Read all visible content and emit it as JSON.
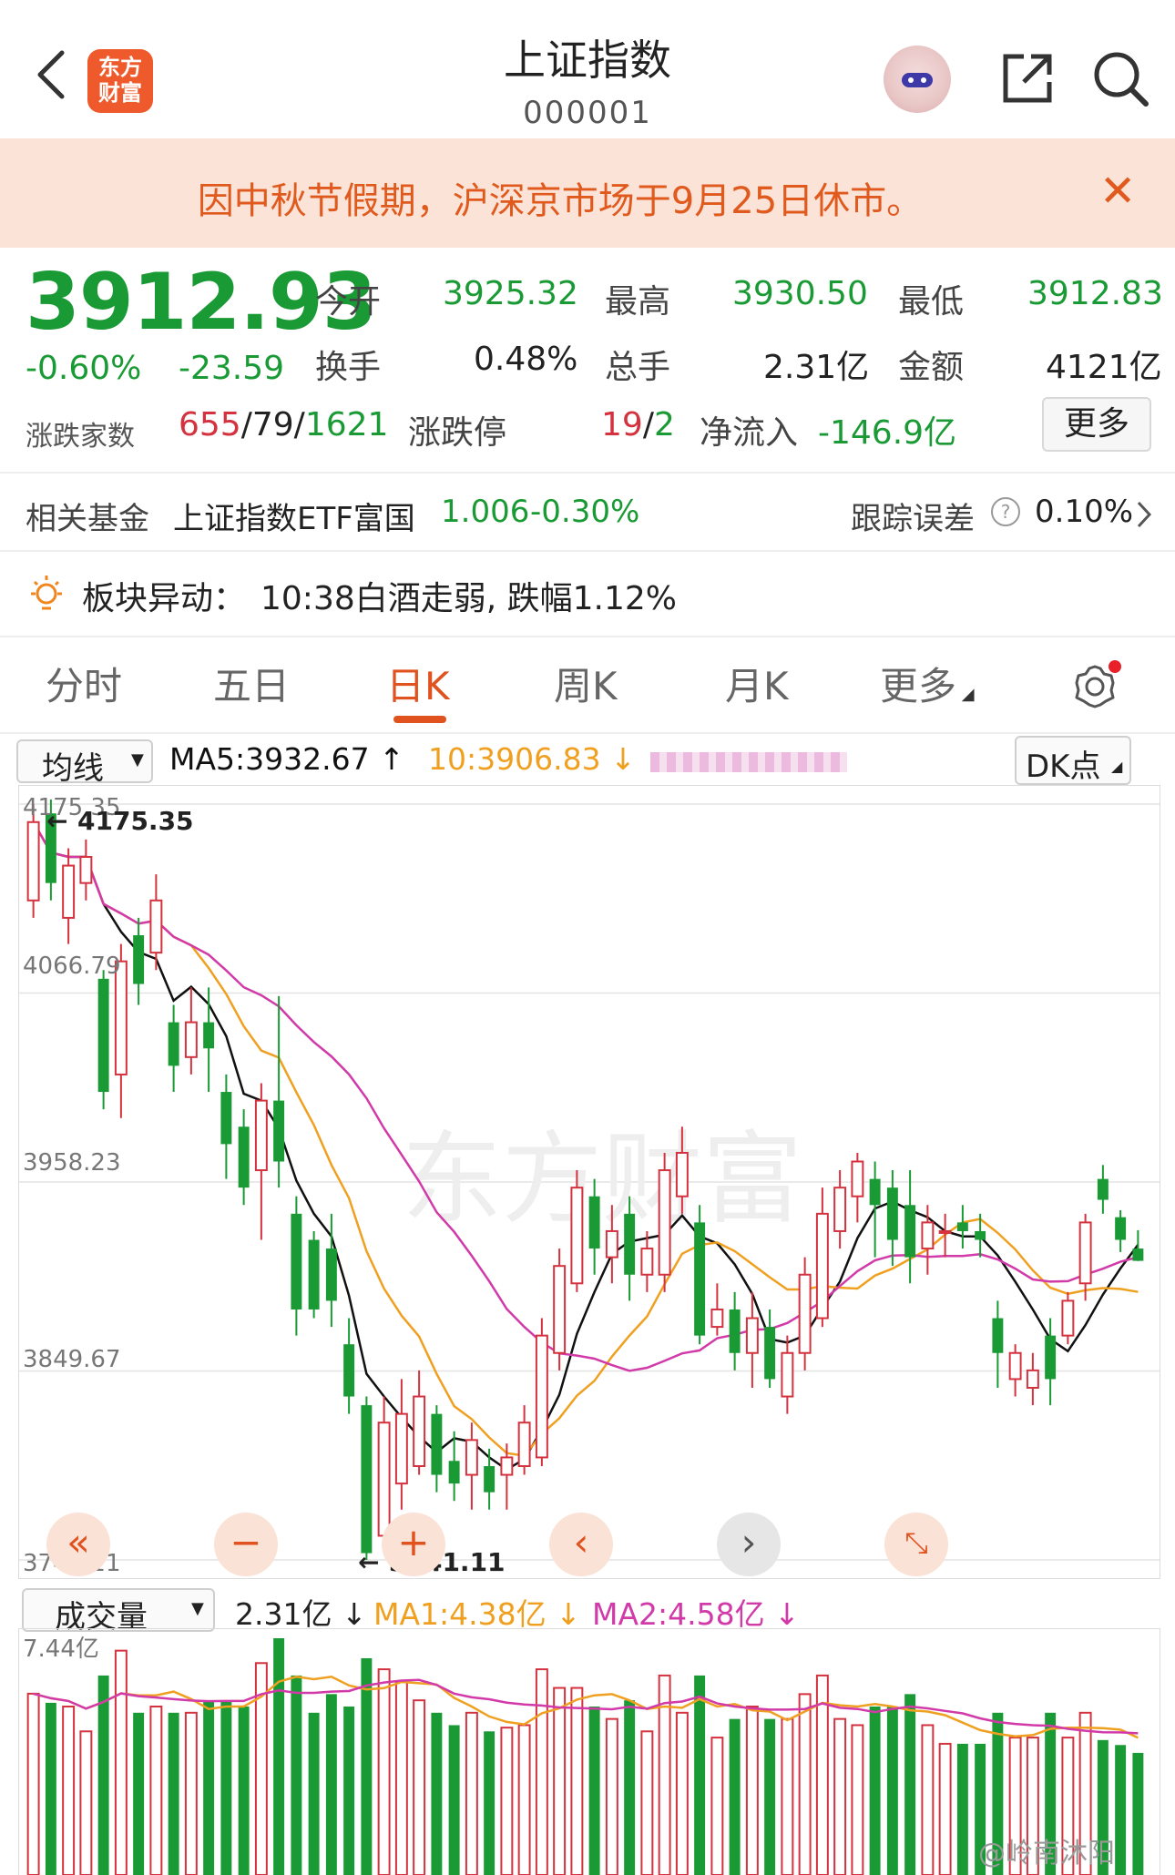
{
  "header": {
    "title": "上证指数",
    "code": "000001",
    "logo_text_line1": "东方",
    "logo_text_line2": "财富"
  },
  "notice": {
    "text": "因中秋节假期，沪深京市场于9月25日休市。"
  },
  "quote": {
    "price": "3912.93",
    "change_pct": "-0.60%",
    "change": "-23.59",
    "open_label": "今开",
    "open": "3925.32",
    "high_label": "最高",
    "high": "3930.50",
    "low_label": "最低",
    "low": "3912.83",
    "turnover_label": "换手",
    "turnover": "0.48%",
    "volume_label": "总手",
    "volume": "2.31亿",
    "amount_label": "金额",
    "amount": "4121亿",
    "breadth_label": "涨跌家数",
    "breadth_up": "655",
    "breadth_flat": "79",
    "breadth_down": "1621",
    "limit_label": "涨跌停",
    "limit_up": "19",
    "limit_down": "2",
    "inflow_label": "净流入",
    "inflow": "-146.9亿",
    "more_label": "更多"
  },
  "fund": {
    "label": "相关基金",
    "name": "上证指数ETF富国",
    "value": "1.006",
    "pct": "-0.30%",
    "track_label": "跟踪误差",
    "track_value": "0.10%"
  },
  "alert": {
    "label": "板块异动：",
    "text": "10:38白酒走弱, 跌幅1.12%"
  },
  "tabs": [
    {
      "label": "分时"
    },
    {
      "label": "五日"
    },
    {
      "label": "日K"
    },
    {
      "label": "周K"
    },
    {
      "label": "月K"
    },
    {
      "label": "更多"
    }
  ],
  "ma_bar": {
    "selector": "均线",
    "ma5": "MA5:3932.67",
    "ma10": "10:3906.83",
    "dk": "DK点"
  },
  "chart_axis": {
    "y1": "4175.35",
    "y2": "4066.79",
    "y3": "3958.23",
    "y4": "3849.67",
    "y5": "3741.11",
    "max_mark": "4175.35",
    "min_mark": "3741.11",
    "watermark": "东方财富"
  },
  "vol_bar": {
    "selector": "成交量",
    "vol": "2.31亿",
    "ma1": "MA1:4.38亿",
    "ma2": "MA2:4.58亿",
    "top": "7.44亿"
  },
  "footer": {
    "weibo": "@岭南沐阳"
  },
  "colors": {
    "up": "#d4323f",
    "down": "#1a9a34",
    "accent": "#e0521e",
    "ma5": "#111111",
    "ma10": "#f0a020",
    "ma20": "#d13aa8"
  },
  "chart_data": {
    "type": "candlestick",
    "ylim": [
      3741.11,
      4175.35
    ],
    "candles": [
      {
        "o": 4120,
        "c": 4165,
        "h": 4175.35,
        "l": 4110
      },
      {
        "o": 4170,
        "c": 4130,
        "h": 4178,
        "l": 4120
      },
      {
        "o": 4110,
        "c": 4140,
        "h": 4150,
        "l": 4095
      },
      {
        "o": 4130,
        "c": 4145,
        "h": 4155,
        "l": 4120
      },
      {
        "o": 4075,
        "c": 4010,
        "h": 4080,
        "l": 4000
      },
      {
        "o": 4020,
        "c": 4085,
        "h": 4095,
        "l": 3995
      },
      {
        "o": 4100,
        "c": 4072,
        "h": 4110,
        "l": 4060
      },
      {
        "o": 4090,
        "c": 4120,
        "h": 4135,
        "l": 4080
      },
      {
        "o": 4050,
        "c": 4025,
        "h": 4060,
        "l": 4010
      },
      {
        "o": 4030,
        "c": 4050,
        "h": 4070,
        "l": 4020
      },
      {
        "o": 4050,
        "c": 4035,
        "h": 4070,
        "l": 4010
      },
      {
        "o": 4010,
        "c": 3980,
        "h": 4020,
        "l": 3960
      },
      {
        "o": 3990,
        "c": 3955,
        "h": 4000,
        "l": 3945
      },
      {
        "o": 3965,
        "c": 4005,
        "h": 4015,
        "l": 3925
      },
      {
        "o": 4005,
        "c": 3970,
        "h": 4065,
        "l": 3955
      },
      {
        "o": 3940,
        "c": 3885,
        "h": 3950,
        "l": 3870
      },
      {
        "o": 3925,
        "c": 3885,
        "h": 3930,
        "l": 3880
      },
      {
        "o": 3920,
        "c": 3890,
        "h": 3940,
        "l": 3875
      },
      {
        "o": 3865,
        "c": 3835,
        "h": 3880,
        "l": 3825
      },
      {
        "o": 3830,
        "c": 3745,
        "h": 3835,
        "l": 3741.11
      },
      {
        "o": 3755,
        "c": 3820,
        "h": 3835,
        "l": 3750
      },
      {
        "o": 3785,
        "c": 3825,
        "h": 3845,
        "l": 3770
      },
      {
        "o": 3795,
        "c": 3835,
        "h": 3850,
        "l": 3790
      },
      {
        "o": 3825,
        "c": 3790,
        "h": 3830,
        "l": 3780
      },
      {
        "o": 3798,
        "c": 3785,
        "h": 3815,
        "l": 3775
      },
      {
        "o": 3790,
        "c": 3810,
        "h": 3820,
        "l": 3770
      },
      {
        "o": 3795,
        "c": 3780,
        "h": 3805,
        "l": 3770
      },
      {
        "o": 3790,
        "c": 3800,
        "h": 3808,
        "l": 3770
      },
      {
        "o": 3795,
        "c": 3820,
        "h": 3830,
        "l": 3790
      },
      {
        "o": 3800,
        "c": 3870,
        "h": 3880,
        "l": 3795
      },
      {
        "o": 3860,
        "c": 3910,
        "h": 3920,
        "l": 3850
      },
      {
        "o": 3900,
        "c": 3955,
        "h": 3965,
        "l": 3895
      },
      {
        "o": 3950,
        "c": 3920,
        "h": 3960,
        "l": 3905
      },
      {
        "o": 3915,
        "c": 3930,
        "h": 3945,
        "l": 3900
      },
      {
        "o": 3940,
        "c": 3905,
        "h": 3950,
        "l": 3890
      },
      {
        "o": 3905,
        "c": 3920,
        "h": 3930,
        "l": 3895
      },
      {
        "o": 3905,
        "c": 3965,
        "h": 3975,
        "l": 3895
      },
      {
        "o": 3950,
        "c": 3975,
        "h": 3990,
        "l": 3940
      },
      {
        "o": 3935,
        "c": 3870,
        "h": 3945,
        "l": 3865
      },
      {
        "o": 3875,
        "c": 3885,
        "h": 3900,
        "l": 3870
      },
      {
        "o": 3885,
        "c": 3860,
        "h": 3895,
        "l": 3850
      },
      {
        "o": 3860,
        "c": 3880,
        "h": 3895,
        "l": 3840
      },
      {
        "o": 3875,
        "c": 3845,
        "h": 3885,
        "l": 3840
      },
      {
        "o": 3835,
        "c": 3860,
        "h": 3870,
        "l": 3825
      },
      {
        "o": 3860,
        "c": 3905,
        "h": 3915,
        "l": 3850
      },
      {
        "o": 3880,
        "c": 3940,
        "h": 3955,
        "l": 3875
      },
      {
        "o": 3930,
        "c": 3955,
        "h": 3965,
        "l": 3920
      },
      {
        "o": 3950,
        "c": 3970,
        "h": 3975,
        "l": 3935
      },
      {
        "o": 3960,
        "c": 3945,
        "h": 3970,
        "l": 3915
      },
      {
        "o": 3955,
        "c": 3925,
        "h": 3965,
        "l": 3910
      },
      {
        "o": 3945,
        "c": 3915,
        "h": 3965,
        "l": 3900
      },
      {
        "o": 3920,
        "c": 3935,
        "h": 3945,
        "l": 3905
      },
      {
        "o": 3930,
        "c": 3930,
        "h": 3940,
        "l": 3915
      },
      {
        "o": 3935,
        "c": 3930,
        "h": 3945,
        "l": 3920
      },
      {
        "o": 3930,
        "c": 3925,
        "h": 3940,
        "l": 3915
      },
      {
        "o": 3880,
        "c": 3860,
        "h": 3890,
        "l": 3840
      },
      {
        "o": 3845,
        "c": 3860,
        "h": 3865,
        "l": 3835
      },
      {
        "o": 3840,
        "c": 3850,
        "h": 3860,
        "l": 3830
      },
      {
        "o": 3870,
        "c": 3845,
        "h": 3880,
        "l": 3830
      },
      {
        "o": 3870,
        "c": 3890,
        "h": 3895,
        "l": 3865
      },
      {
        "o": 3900,
        "c": 3935,
        "h": 3940,
        "l": 3890
      },
      {
        "o": 3960,
        "c": 3948,
        "h": 3968,
        "l": 3940
      },
      {
        "o": 3938,
        "c": 3925,
        "h": 3942,
        "l": 3918
      },
      {
        "o": 3920,
        "c": 3912.93,
        "h": 3930.5,
        "l": 3912.83
      }
    ]
  }
}
